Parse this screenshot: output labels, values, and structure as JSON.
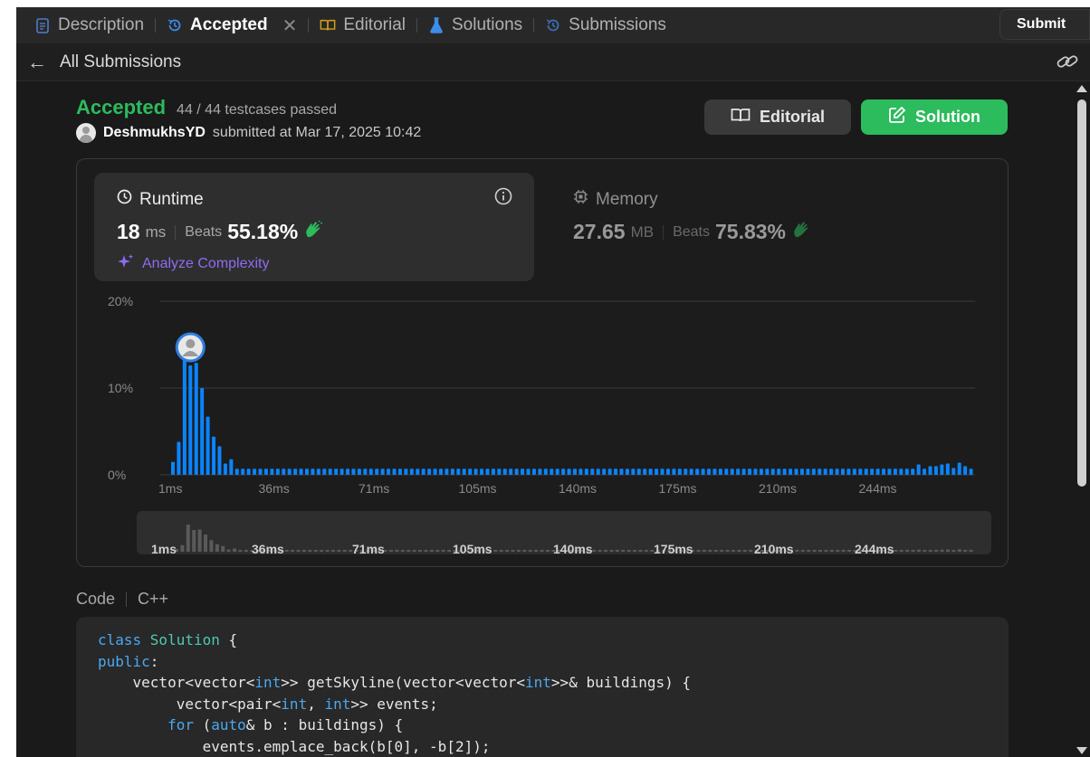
{
  "tabs": [
    {
      "label": "Description",
      "icon": "document-icon"
    },
    {
      "label": "Accepted",
      "icon": "history-icon",
      "active": true,
      "closable": true
    },
    {
      "label": "Editorial",
      "icon": "book-icon"
    },
    {
      "label": "Solutions",
      "icon": "flask-icon"
    },
    {
      "label": "Submissions",
      "icon": "history-icon"
    }
  ],
  "toolbar": {
    "submit_label": "Submit"
  },
  "back": {
    "label": "All Submissions"
  },
  "result": {
    "status": "Accepted",
    "testcases": "44 / 44 testcases passed",
    "username": "DeshmukhsYD",
    "submitted_text": "submitted at Mar 17, 2025 10:42"
  },
  "actions": {
    "editorial_label": "Editorial",
    "solution_label": "Solution"
  },
  "runtime": {
    "label": "Runtime",
    "value": "18",
    "unit": "ms",
    "beats_label": "Beats",
    "beats_value": "55.18%",
    "analyze_label": "Analyze Complexity"
  },
  "memory": {
    "label": "Memory",
    "value": "27.65",
    "unit": "MB",
    "beats_label": "Beats",
    "beats_value": "75.83%"
  },
  "colors": {
    "accent_green": "#2cbb5d",
    "bar_blue": "#0a84ff",
    "analyze_purple": "#8e6cf2"
  },
  "chart_data": {
    "type": "bar",
    "y_ticks": [
      "0%",
      "10%",
      "20%"
    ],
    "ylim": [
      0,
      20
    ],
    "x_tick_labels": [
      "1ms",
      "36ms",
      "71ms",
      "105ms",
      "140ms",
      "175ms",
      "210ms",
      "244ms"
    ],
    "values": [
      1.5,
      3.8,
      15.8,
      12.6,
      12.9,
      10,
      6.7,
      4.4,
      3.3,
      1.3,
      1.8,
      0.7,
      0.7,
      0.7,
      0.7,
      0.7,
      0.7,
      0.7,
      0.7,
      0.7,
      0.7,
      0.7,
      0.7,
      0.7,
      0.7,
      0.7,
      0.7,
      0.7,
      0.7,
      0.7,
      0.7,
      0.7,
      0.7,
      0.7,
      0.7,
      0.7,
      0.7,
      0.7,
      0.7,
      0.7,
      0.7,
      0.7,
      0.7,
      0.7,
      0.7,
      0.7,
      0.7,
      0.7,
      0.7,
      0.7,
      0.7,
      0.7,
      0.7,
      0.7,
      0.7,
      0.7,
      0.7,
      0.7,
      0.7,
      0.7,
      0.7,
      0.7,
      0.7,
      0.7,
      0.7,
      0.7,
      0.7,
      0.7,
      0.7,
      0.7,
      0.7,
      0.7,
      0.7,
      0.7,
      0.7,
      0.7,
      0.7,
      0.7,
      0.7,
      0.7,
      0.7,
      0.7,
      0.7,
      0.7,
      0.7,
      0.7,
      0.7,
      0.7,
      0.7,
      0.7,
      0.7,
      0.7,
      0.7,
      0.7,
      0.7,
      0.7,
      0.7,
      0.7,
      0.7,
      0.7,
      0.7,
      0.7,
      0.7,
      0.7,
      0.7,
      0.7,
      0.7,
      0.7,
      0.7,
      0.7,
      0.7,
      0.7,
      0.7,
      0.7,
      0.7,
      0.7,
      0.7,
      0.7,
      0.7,
      0.7,
      0.7,
      0.7,
      0.7,
      0.7,
      0.7,
      0.7,
      0.7,
      0.7,
      1.2,
      0.7,
      1.0,
      1.0,
      1.2,
      1.3,
      0.8,
      1.4,
      1.0,
      0.7
    ],
    "highlight_index": 3,
    "grid": true
  },
  "code": {
    "header_label": "Code",
    "language": "C++",
    "lines": [
      [
        {
          "t": "class ",
          "c": "kw"
        },
        {
          "t": "Solution",
          "c": "cls"
        },
        {
          "t": " {",
          "c": ""
        }
      ],
      [
        {
          "t": "public",
          "c": "kw"
        },
        {
          "t": ":",
          "c": ""
        }
      ],
      [
        {
          "t": "    vector<vector<",
          "c": ""
        },
        {
          "t": "int",
          "c": "kw"
        },
        {
          "t": ">> getSkyline(vector<vector<",
          "c": ""
        },
        {
          "t": "int",
          "c": "kw"
        },
        {
          "t": ">>& buildings) {",
          "c": ""
        }
      ],
      [
        {
          "t": "         vector<pair<",
          "c": ""
        },
        {
          "t": "int",
          "c": "kw"
        },
        {
          "t": ", ",
          "c": ""
        },
        {
          "t": "int",
          "c": "kw"
        },
        {
          "t": ">> events;",
          "c": ""
        }
      ],
      [
        {
          "t": "        ",
          "c": ""
        },
        {
          "t": "for",
          "c": "kw"
        },
        {
          "t": " (",
          "c": ""
        },
        {
          "t": "auto",
          "c": "kw"
        },
        {
          "t": "& b : buildings) {",
          "c": ""
        }
      ],
      [
        {
          "t": "            events.emplace_back(b[0], -b[2]);",
          "c": ""
        }
      ]
    ]
  }
}
